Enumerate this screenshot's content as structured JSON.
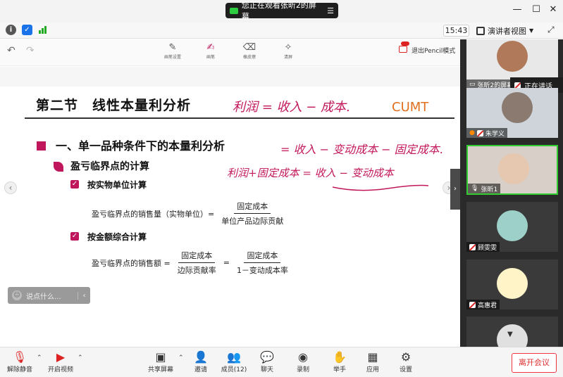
{
  "titlebar": {
    "share_banner": "您正在观看张昕2的屏幕",
    "minimize": "—",
    "maximize": "☐",
    "close": "✕"
  },
  "toolbar": {
    "time": "15:43",
    "view_mode": "演讲者视图"
  },
  "pencil_toolbar": {
    "tools": [
      {
        "label": "画笔设置",
        "icon": "pen-settings-icon"
      },
      {
        "label": "画笔",
        "icon": "pen-icon"
      },
      {
        "label": "橡皮擦",
        "icon": "eraser-icon"
      },
      {
        "label": "清屏",
        "icon": "clear-screen-icon"
      }
    ],
    "exit_label": "退出Pencil模式"
  },
  "slide": {
    "title": "第二节　线性本量利分析",
    "section": "一、单一品种条件下的本量利分析",
    "subsection": "盈亏临界点的计算",
    "items": [
      {
        "label": "按实物单位计算",
        "formula_left": "盈亏临界点的销售量（实物单位）=",
        "numerator": "固定成本",
        "denominator": "单位产品边际贡献"
      },
      {
        "label": "按金额综合计算",
        "formula_left": "盈亏临界点的销售额 =",
        "numerator": "固定成本",
        "denominator": "边际贡献率",
        "formula_mid": "=",
        "numerator2": "固定成本",
        "denominator2": "1－变动成本率"
      }
    ],
    "handwriting": [
      "利润 = 收入 − 成本.",
      "= 收入 − 变动成本 − 固定成本.",
      "利润+固定成本 = 收入 − 变动成本"
    ],
    "cumt": "CUMT",
    "chat_placeholder": "说点什么..."
  },
  "participants": [
    {
      "name": "张昕2的屏幕共享",
      "mic": "on"
    },
    {
      "name": "朱学义",
      "mic": "off"
    },
    {
      "name": "张昕1",
      "mic": "on"
    },
    {
      "name": "顾雯雯",
      "mic": "off"
    },
    {
      "name": "高惠君",
      "mic": "off"
    },
    {
      "name": "",
      "mic": "off"
    }
  ],
  "speaking_label": "正在讲话",
  "bottombar": {
    "buttons": [
      {
        "label": "解除静音",
        "icon": "mic-muted-icon"
      },
      {
        "label": "开启视频",
        "icon": "video-off-icon"
      },
      {
        "label": "共享屏幕",
        "icon": "share-screen-icon"
      },
      {
        "label": "邀请",
        "icon": "invite-icon"
      },
      {
        "label": "成员(12)",
        "icon": "members-icon"
      },
      {
        "label": "聊天",
        "icon": "chat-icon"
      },
      {
        "label": "录制",
        "icon": "record-icon"
      },
      {
        "label": "举手",
        "icon": "raise-hand-icon"
      },
      {
        "label": "应用",
        "icon": "apps-icon"
      },
      {
        "label": "设置",
        "icon": "settings-icon"
      }
    ],
    "leave_label": "离开会议"
  },
  "colors": {
    "accent": "#c0175c",
    "handwriting": "#c2185b",
    "cumt": "#e07020",
    "leave": "#e03030"
  }
}
